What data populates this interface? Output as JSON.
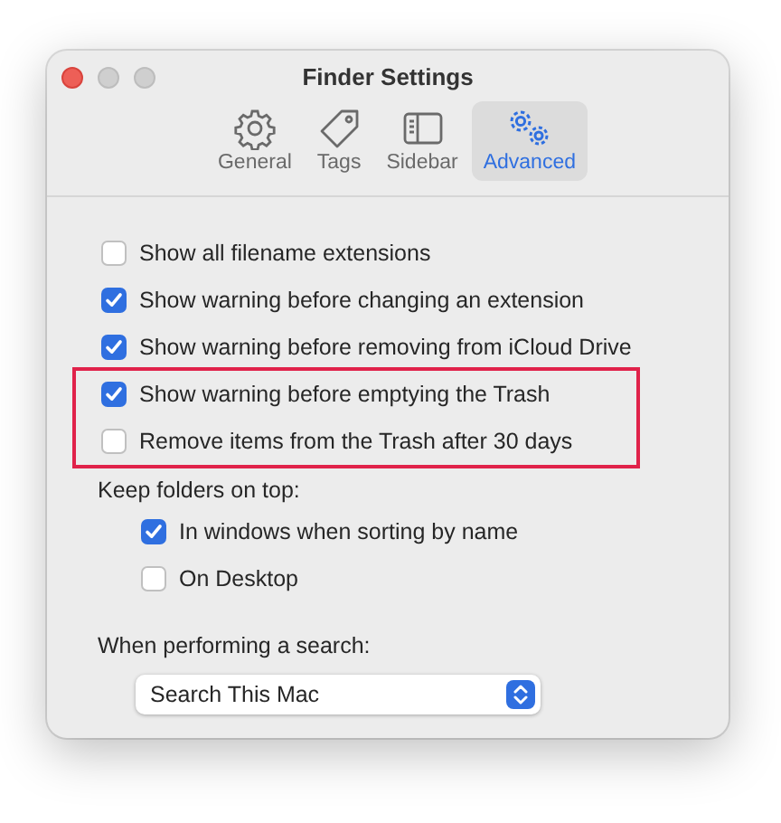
{
  "window": {
    "title": "Finder Settings"
  },
  "tabs": [
    {
      "label": "General",
      "kind": "gear",
      "selected": false
    },
    {
      "label": "Tags",
      "kind": "tag",
      "selected": false
    },
    {
      "label": "Sidebar",
      "kind": "sidebar",
      "selected": false
    },
    {
      "label": "Advanced",
      "kind": "gears",
      "selected": true
    }
  ],
  "options": [
    {
      "label": "Show all filename extensions",
      "checked": false,
      "highlighted": false
    },
    {
      "label": "Show warning before changing an extension",
      "checked": true,
      "highlighted": false
    },
    {
      "label": "Show warning before removing from iCloud Drive",
      "checked": true,
      "highlighted": false
    },
    {
      "label": "Show warning before emptying the Trash",
      "checked": true,
      "highlighted": true
    },
    {
      "label": "Remove items from the Trash after 30 days",
      "checked": false,
      "highlighted": true
    }
  ],
  "keep_folders": {
    "label": "Keep folders on top:",
    "options": [
      {
        "label": "In windows when sorting by name",
        "checked": true
      },
      {
        "label": "On Desktop",
        "checked": false
      }
    ]
  },
  "search": {
    "label": "When performing a search:",
    "value": "Search This Mac"
  }
}
